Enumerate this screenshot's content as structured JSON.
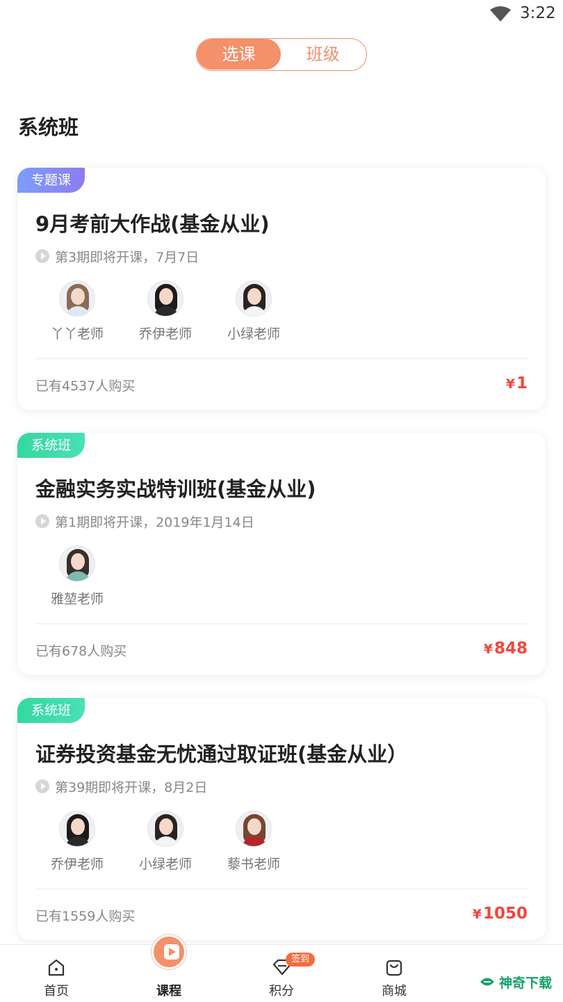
{
  "status": {
    "time": "3:22"
  },
  "segment": {
    "active": "选课",
    "inactive": "班级"
  },
  "section_title": "系统班",
  "cards": [
    {
      "tag": "专题课",
      "title": "9月考前大作战(基金从业)",
      "schedule": "第3期即将开课，7月7日",
      "teachers": [
        "丫丫老师",
        "乔伊老师",
        "小绿老师"
      ],
      "buyers": "已有4537人购买",
      "price": "1"
    },
    {
      "tag": "系统班",
      "title": "金融实务实战特训班(基金从业)",
      "schedule": "第1期即将开课，2019年1月14日",
      "teachers": [
        "雅堃老师"
      ],
      "buyers": "已有678人购买",
      "price": "848"
    },
    {
      "tag": "系统班",
      "title": "证券投资基金无忧通过取证班(基金从业）",
      "schedule": "第39期即将开课，8月2日",
      "teachers": [
        "乔伊老师",
        "小绿老师",
        "藜书老师"
      ],
      "buyers": "已有1559人购买",
      "price": "1050"
    }
  ],
  "currency": "¥",
  "tabbar": {
    "items": [
      {
        "label": "首页",
        "icon": "home-icon"
      },
      {
        "label": "课程",
        "icon": "play-icon"
      },
      {
        "label": "积分",
        "icon": "diamond-icon",
        "badge": "签到"
      },
      {
        "label": "商城",
        "icon": "bag-icon"
      }
    ]
  },
  "watermark": "神奇下载",
  "colors": {
    "accent": "#f4906a",
    "price": "#f0473e",
    "topic_tag": "#7d9dfb",
    "system_tag": "#35d8a0"
  }
}
